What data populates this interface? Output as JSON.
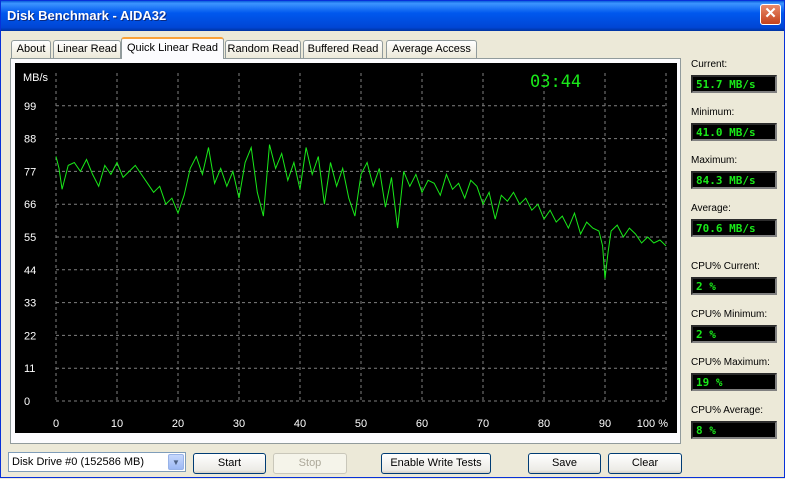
{
  "window": {
    "title": "Disk Benchmark - AIDA32",
    "close_glyph": "✕"
  },
  "tabs": [
    {
      "label": "About"
    },
    {
      "label": "Linear Read"
    },
    {
      "label": "Quick Linear Read"
    },
    {
      "label": "Random Read"
    },
    {
      "label": "Buffered Read"
    },
    {
      "label": "Average Access"
    }
  ],
  "active_tab": "Quick Linear Read",
  "chart_data": {
    "type": "line",
    "ylabel": "MB/s",
    "y_ticks": [
      0,
      11,
      22,
      33,
      44,
      55,
      66,
      77,
      88,
      99
    ],
    "x_ticks": [
      "0",
      "10",
      "20",
      "30",
      "40",
      "50",
      "60",
      "70",
      "80",
      "90",
      "100 %"
    ],
    "ylim": [
      0,
      110
    ],
    "xlim": [
      0,
      100
    ],
    "timer": "03:44",
    "grid": true,
    "colors": {
      "line": "#19e819",
      "grid": "#808080",
      "background": "#000000",
      "text": "#ffffff"
    },
    "series": [
      {
        "x": [
          0,
          0.5,
          1,
          2,
          3,
          4,
          5,
          6,
          7,
          8,
          9,
          10,
          11,
          12,
          13,
          14,
          15,
          16,
          17,
          18,
          19,
          20,
          21,
          22,
          23,
          24,
          25,
          26,
          27,
          28,
          29,
          30,
          31,
          32,
          33,
          34,
          35,
          36,
          37,
          38,
          39,
          40,
          41,
          42,
          43,
          44,
          45,
          46,
          47,
          48,
          49,
          50,
          51,
          52,
          53,
          54,
          55,
          56,
          57,
          58,
          59,
          60,
          61,
          62,
          63,
          64,
          65,
          66,
          67,
          68,
          69,
          70,
          71,
          72,
          73,
          74,
          75,
          76,
          77,
          78,
          79,
          80,
          81,
          82,
          83,
          84,
          85,
          86,
          87,
          88,
          89,
          89.6,
          90,
          90.5,
          91,
          92,
          93,
          94,
          95,
          96,
          97,
          98,
          99,
          100
        ],
        "values": [
          82,
          78,
          71,
          79,
          80,
          77,
          81,
          76,
          72,
          79,
          76,
          80,
          75,
          77,
          79,
          76,
          73,
          70,
          72,
          66,
          68,
          63,
          69,
          78,
          82,
          76,
          85,
          73,
          78,
          72,
          77,
          68,
          80,
          85,
          70,
          62,
          86,
          78,
          83,
          74,
          80,
          71,
          85,
          76,
          82,
          66,
          80,
          72,
          78,
          68,
          62,
          76,
          80,
          72,
          78,
          65,
          75,
          58,
          77,
          72,
          76,
          70,
          74,
          73,
          69,
          76,
          71,
          73,
          68,
          74,
          72,
          66,
          70,
          61,
          69,
          67,
          70,
          66,
          68,
          64,
          66,
          61,
          64,
          60,
          62,
          58,
          63,
          56,
          60,
          58,
          57,
          52,
          41,
          50,
          57,
          59,
          55,
          58,
          56,
          53,
          55,
          53,
          54,
          52
        ]
      }
    ]
  },
  "stats": [
    {
      "label": "Current:",
      "value": "51.7 MB/s"
    },
    {
      "label": "Minimum:",
      "value": "41.0 MB/s"
    },
    {
      "label": "Maximum:",
      "value": "84.3 MB/s"
    },
    {
      "label": "Average:",
      "value": "70.6 MB/s"
    },
    {
      "label": "CPU% Current:",
      "value": "2 %"
    },
    {
      "label": "CPU% Minimum:",
      "value": "2 %"
    },
    {
      "label": "CPU% Maximum:",
      "value": "19 %"
    },
    {
      "label": "CPU% Average:",
      "value": "8 %"
    }
  ],
  "bottom": {
    "drive_select": "Disk Drive #0  (152586 MB)",
    "start": "Start",
    "stop": "Stop",
    "enable_write": "Enable Write Tests",
    "save": "Save",
    "clear": "Clear"
  }
}
